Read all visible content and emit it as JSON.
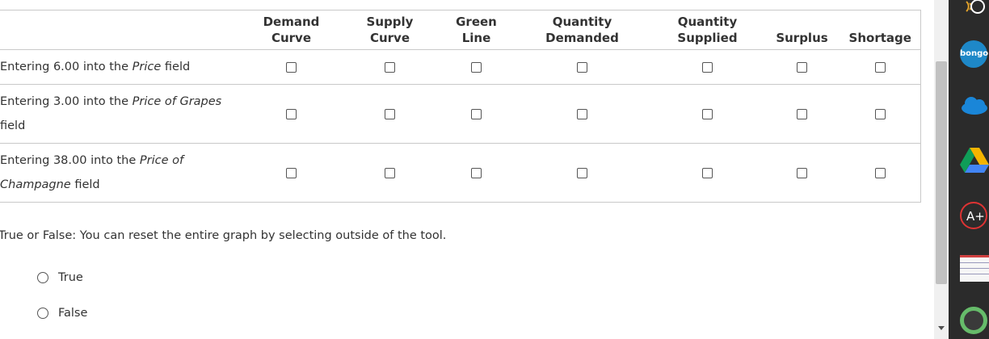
{
  "table": {
    "columns": [
      "",
      "Demand\nCurve",
      "Supply\nCurve",
      "Green\nLine",
      "Quantity\nDemanded",
      "Quantity\nSupplied",
      "Surplus",
      "Shortage"
    ],
    "header": {
      "demand_1": "Demand",
      "demand_2": "Curve",
      "supply_1": "Supply",
      "supply_2": "Curve",
      "green_1": "Green",
      "green_2": "Line",
      "qd_1": "Quantity",
      "qd_2": "Demanded",
      "qs_1": "Quantity",
      "qs_2": "Supplied",
      "surplus": "Surplus",
      "shortage": "Shortage"
    },
    "rows": [
      {
        "prefix": "Entering 6.00 into the ",
        "field": "Price",
        "suffix": " field"
      },
      {
        "prefix": "Entering 3.00 into the ",
        "field": "Price of Grapes",
        "suffix": " field"
      },
      {
        "prefix": "Entering 38.00 into the ",
        "field": "Price of Champagne",
        "suffix": " field"
      }
    ]
  },
  "question": {
    "text": "True or False: You can reset the entire graph by selecting outside of the tool.",
    "options": [
      "True",
      "False"
    ]
  },
  "dock": {
    "items": [
      "broadcast-icon",
      "bongo-icon",
      "onedrive-icon",
      "google-drive-icon",
      "aplus-icon",
      "notebook-icon",
      "circle-app-icon"
    ],
    "bongo_label": "bongo"
  }
}
